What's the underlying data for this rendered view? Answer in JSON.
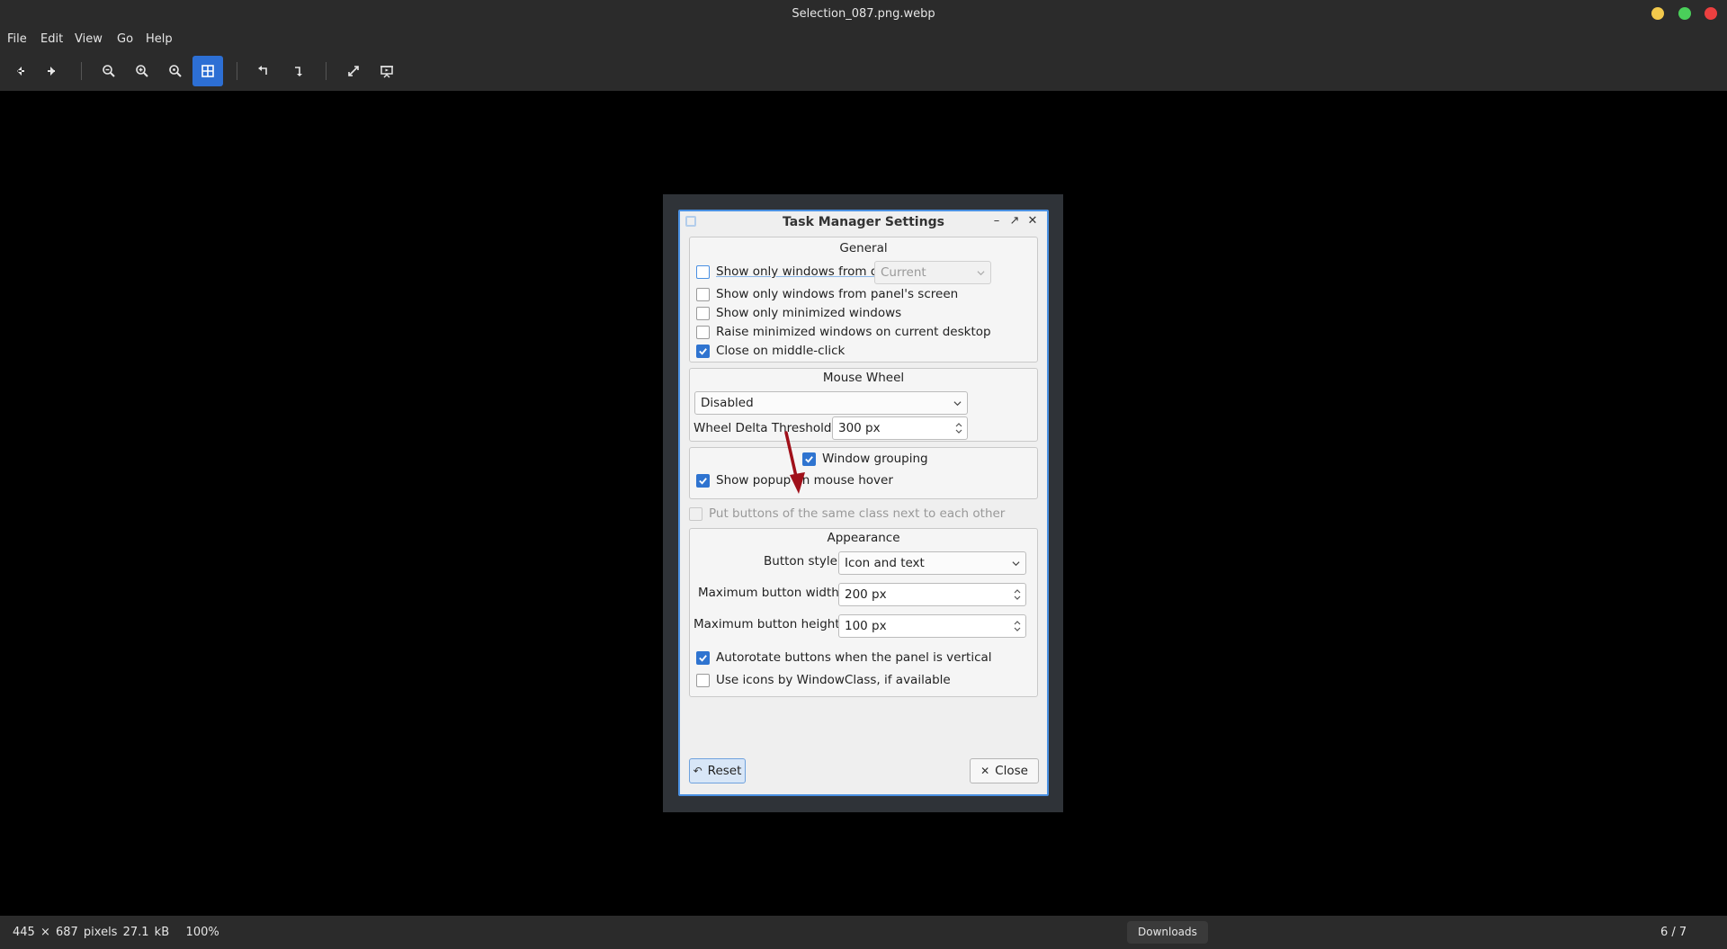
{
  "window": {
    "title": "Selection_087.png.webp"
  },
  "menu": [
    "File",
    "Edit",
    "View",
    "Go",
    "Help"
  ],
  "toolbar_icons": [
    "back-arrow-icon",
    "forward-arrow-icon",
    "zoom-out-icon",
    "zoom-in-icon",
    "zoom-fit-icon",
    "best-fit-icon",
    "rotate-left-icon",
    "rotate-right-icon",
    "fullscreen-icon",
    "slideshow-icon"
  ],
  "status": {
    "dimensions": "445 × 687 pixels",
    "filesize": "27.1 kB",
    "zoom": "100%",
    "folder": "Downloads",
    "position": "6 / 7"
  },
  "dialog": {
    "title": "Task Manager Settings",
    "general": {
      "title": "General",
      "show_desktop": {
        "label": "Show only windows from desktop",
        "checked": false
      },
      "desktop_combo": "Current",
      "show_panel_screen": {
        "label": "Show only windows from panel's screen",
        "checked": false
      },
      "show_minimized": {
        "label": "Show only minimized windows",
        "checked": false
      },
      "raise_minimized": {
        "label": "Raise minimized windows on current desktop",
        "checked": false
      },
      "close_middle": {
        "label": "Close on middle-click",
        "checked": true
      }
    },
    "mouse_wheel": {
      "title": "Mouse Wheel",
      "mode": "Disabled",
      "delta_label": "Wheel Delta Threshold",
      "delta_value": "300 px"
    },
    "grouping": {
      "window_grouping": {
        "label": "Window grouping",
        "checked": true
      },
      "popup_hover": {
        "label": "Show popup on mouse hover",
        "checked": true
      }
    },
    "same_class": {
      "label": "Put buttons of the same class next to each other",
      "checked": false
    },
    "appearance": {
      "title": "Appearance",
      "style_label": "Button style",
      "style_value": "Icon and text",
      "max_width_label": "Maximum button width",
      "max_width_value": "200 px",
      "max_height_label": "Maximum button height",
      "max_height_value": "100 px",
      "autorotate": {
        "label": "Autorotate buttons when the panel is vertical",
        "checked": true
      },
      "windowclass_icons": {
        "label": "Use icons by WindowClass, if available",
        "checked": false
      }
    },
    "buttons": {
      "reset": "Reset",
      "close": "Close"
    }
  },
  "colors": {
    "accent": "#2f74d0",
    "annotation_arrow": "#a0101a",
    "focus_border": "#4a90e2"
  }
}
